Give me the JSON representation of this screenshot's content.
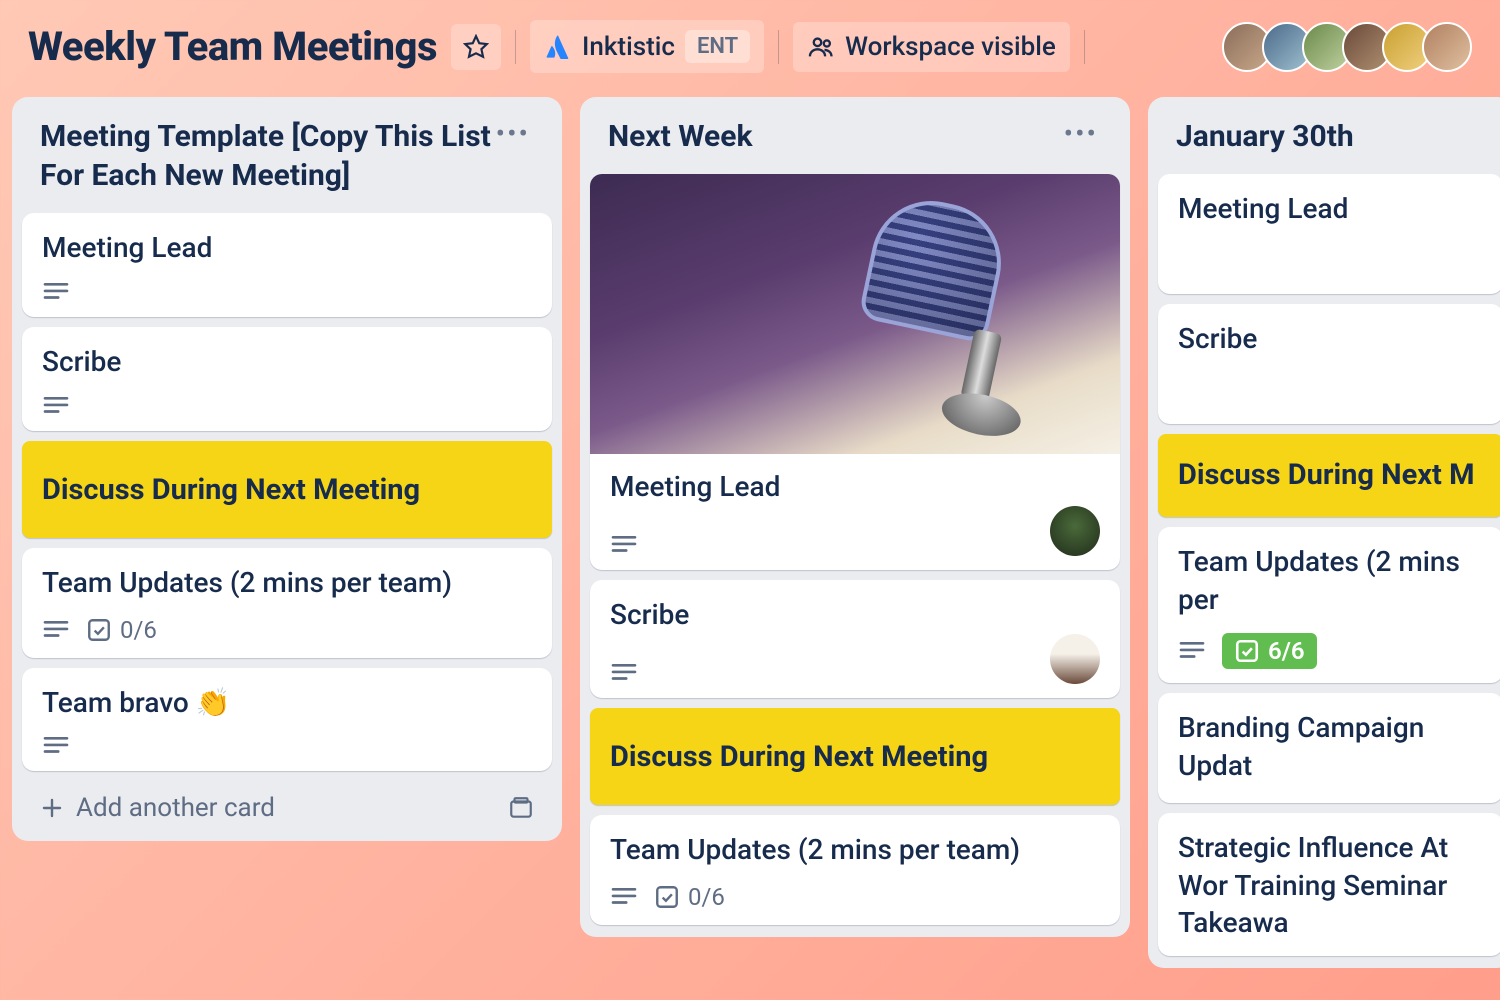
{
  "header": {
    "title": "Weekly Team Meetings",
    "workspace_name": "Inktistic",
    "workspace_badge": "ENT",
    "visibility_label": "Workspace visible"
  },
  "lists": [
    {
      "title": "Meeting Template [Copy This List For Each New Meeting]",
      "cards": [
        {
          "title": "Meeting Lead"
        },
        {
          "title": "Scribe"
        },
        {
          "title": "Discuss During Next Meeting",
          "style": "yellow"
        },
        {
          "title": "Team Updates (2 mins per team)",
          "checklist": "0/6"
        },
        {
          "title": "Team bravo 👏"
        }
      ],
      "add_label": "Add another card"
    },
    {
      "title": "Next Week",
      "cards": [
        {
          "title": "Meeting Lead",
          "cover": true,
          "member": "a"
        },
        {
          "title": "Scribe",
          "member": "b"
        },
        {
          "title": "Discuss During Next Meeting",
          "style": "yellow"
        },
        {
          "title": "Team Updates (2 mins per team)",
          "checklist": "0/6"
        }
      ]
    },
    {
      "title": "January 30th",
      "cards": [
        {
          "title": "Meeting Lead"
        },
        {
          "title": "Scribe"
        },
        {
          "title": "Discuss During Next M",
          "style": "yellow"
        },
        {
          "title": "Team Updates (2 mins per",
          "checklist": "6/6",
          "checklist_done": true
        },
        {
          "title": "Branding Campaign Updat"
        },
        {
          "title": "Strategic Influence At Wor Training Seminar Takeawa"
        }
      ]
    }
  ]
}
